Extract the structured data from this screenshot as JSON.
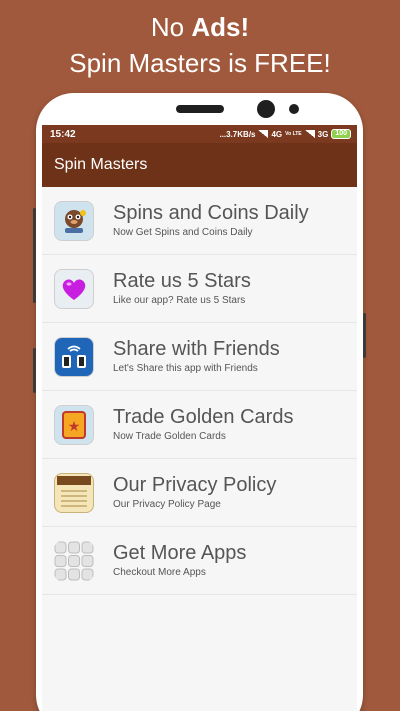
{
  "promo": {
    "line1_prefix": "No ",
    "line1_bold": "Ads!",
    "line2": "Spin Masters is FREE!"
  },
  "status_bar": {
    "time": "15:42",
    "speed": "...3.7KB/s",
    "network1": "4G",
    "volte": "Vo LTE",
    "network2": "3G",
    "battery": "100"
  },
  "app_bar": {
    "title": "Spin Masters"
  },
  "menu": {
    "items": [
      {
        "title": "Spins and Coins Daily",
        "subtitle": "Now Get Spins and Coins Daily",
        "icon": "pig-coins-icon"
      },
      {
        "title": "Rate us 5 Stars",
        "subtitle": "Like our app? Rate us 5 Stars",
        "icon": "heart-icon"
      },
      {
        "title": "Share with Friends",
        "subtitle": "Let's Share this app with Friends",
        "icon": "share-friends-icon"
      },
      {
        "title": "Trade Golden Cards",
        "subtitle": "Now Trade Golden Cards",
        "icon": "golden-card-icon"
      },
      {
        "title": "Our Privacy Policy",
        "subtitle": "Our Privacy Policy Page",
        "icon": "notepad-icon"
      },
      {
        "title": "Get More Apps",
        "subtitle": "Checkout More Apps",
        "icon": "app-grid-icon"
      }
    ]
  },
  "colors": {
    "background": "#a0593c",
    "app_bar": "#6e3219",
    "status_bar": "#7b3a1f",
    "heart": "#c81ee0"
  }
}
